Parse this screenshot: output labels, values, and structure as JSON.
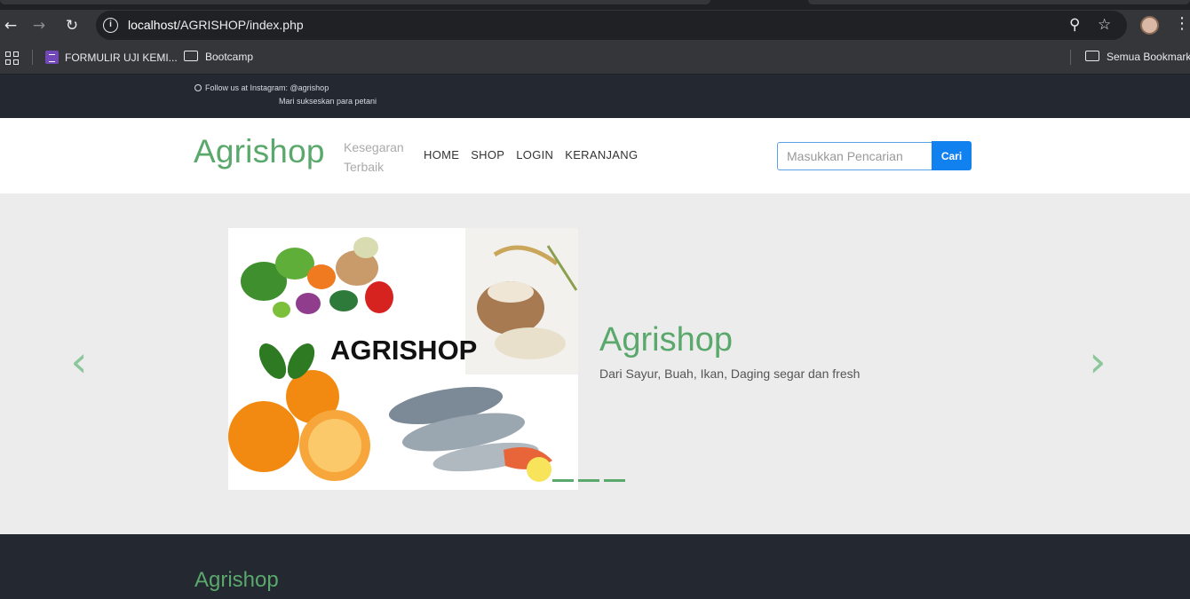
{
  "browser": {
    "url_host": "localhost",
    "url_path": "/AGRISHOP/index.php",
    "bookmarks": [
      {
        "label": "FORMULIR UJI KEMI...",
        "icon": "forms-icon"
      },
      {
        "label": "Bootcamp",
        "icon": "folder-icon"
      }
    ],
    "all_bookmarks_label": "Semua Bookmark"
  },
  "topbar": {
    "instagram": "Follow us at Instagram: @agrishop",
    "slogan": "Mari sukseskan para petani"
  },
  "header": {
    "brand": "Agrishop",
    "tagline_line1": "Kesegaran",
    "tagline_line2": "Terbaik",
    "nav": [
      "HOME",
      "SHOP",
      "LOGIN",
      "KERANJANG"
    ],
    "search_placeholder": "Masukkan Pencarian",
    "search_button": "Cari"
  },
  "hero": {
    "image_text": "AGRISHOP",
    "title": "Agrishop",
    "description": "Dari Sayur, Buah, Ikan, Daging segar dan fresh",
    "prev_icon": "chevron-left-icon",
    "next_icon": "chevron-right-icon",
    "slide_count": 3,
    "colors": {
      "accent": "#5aa86b",
      "arrow": "#8cc69b"
    }
  },
  "footer": {
    "brand": "Agrishop"
  }
}
